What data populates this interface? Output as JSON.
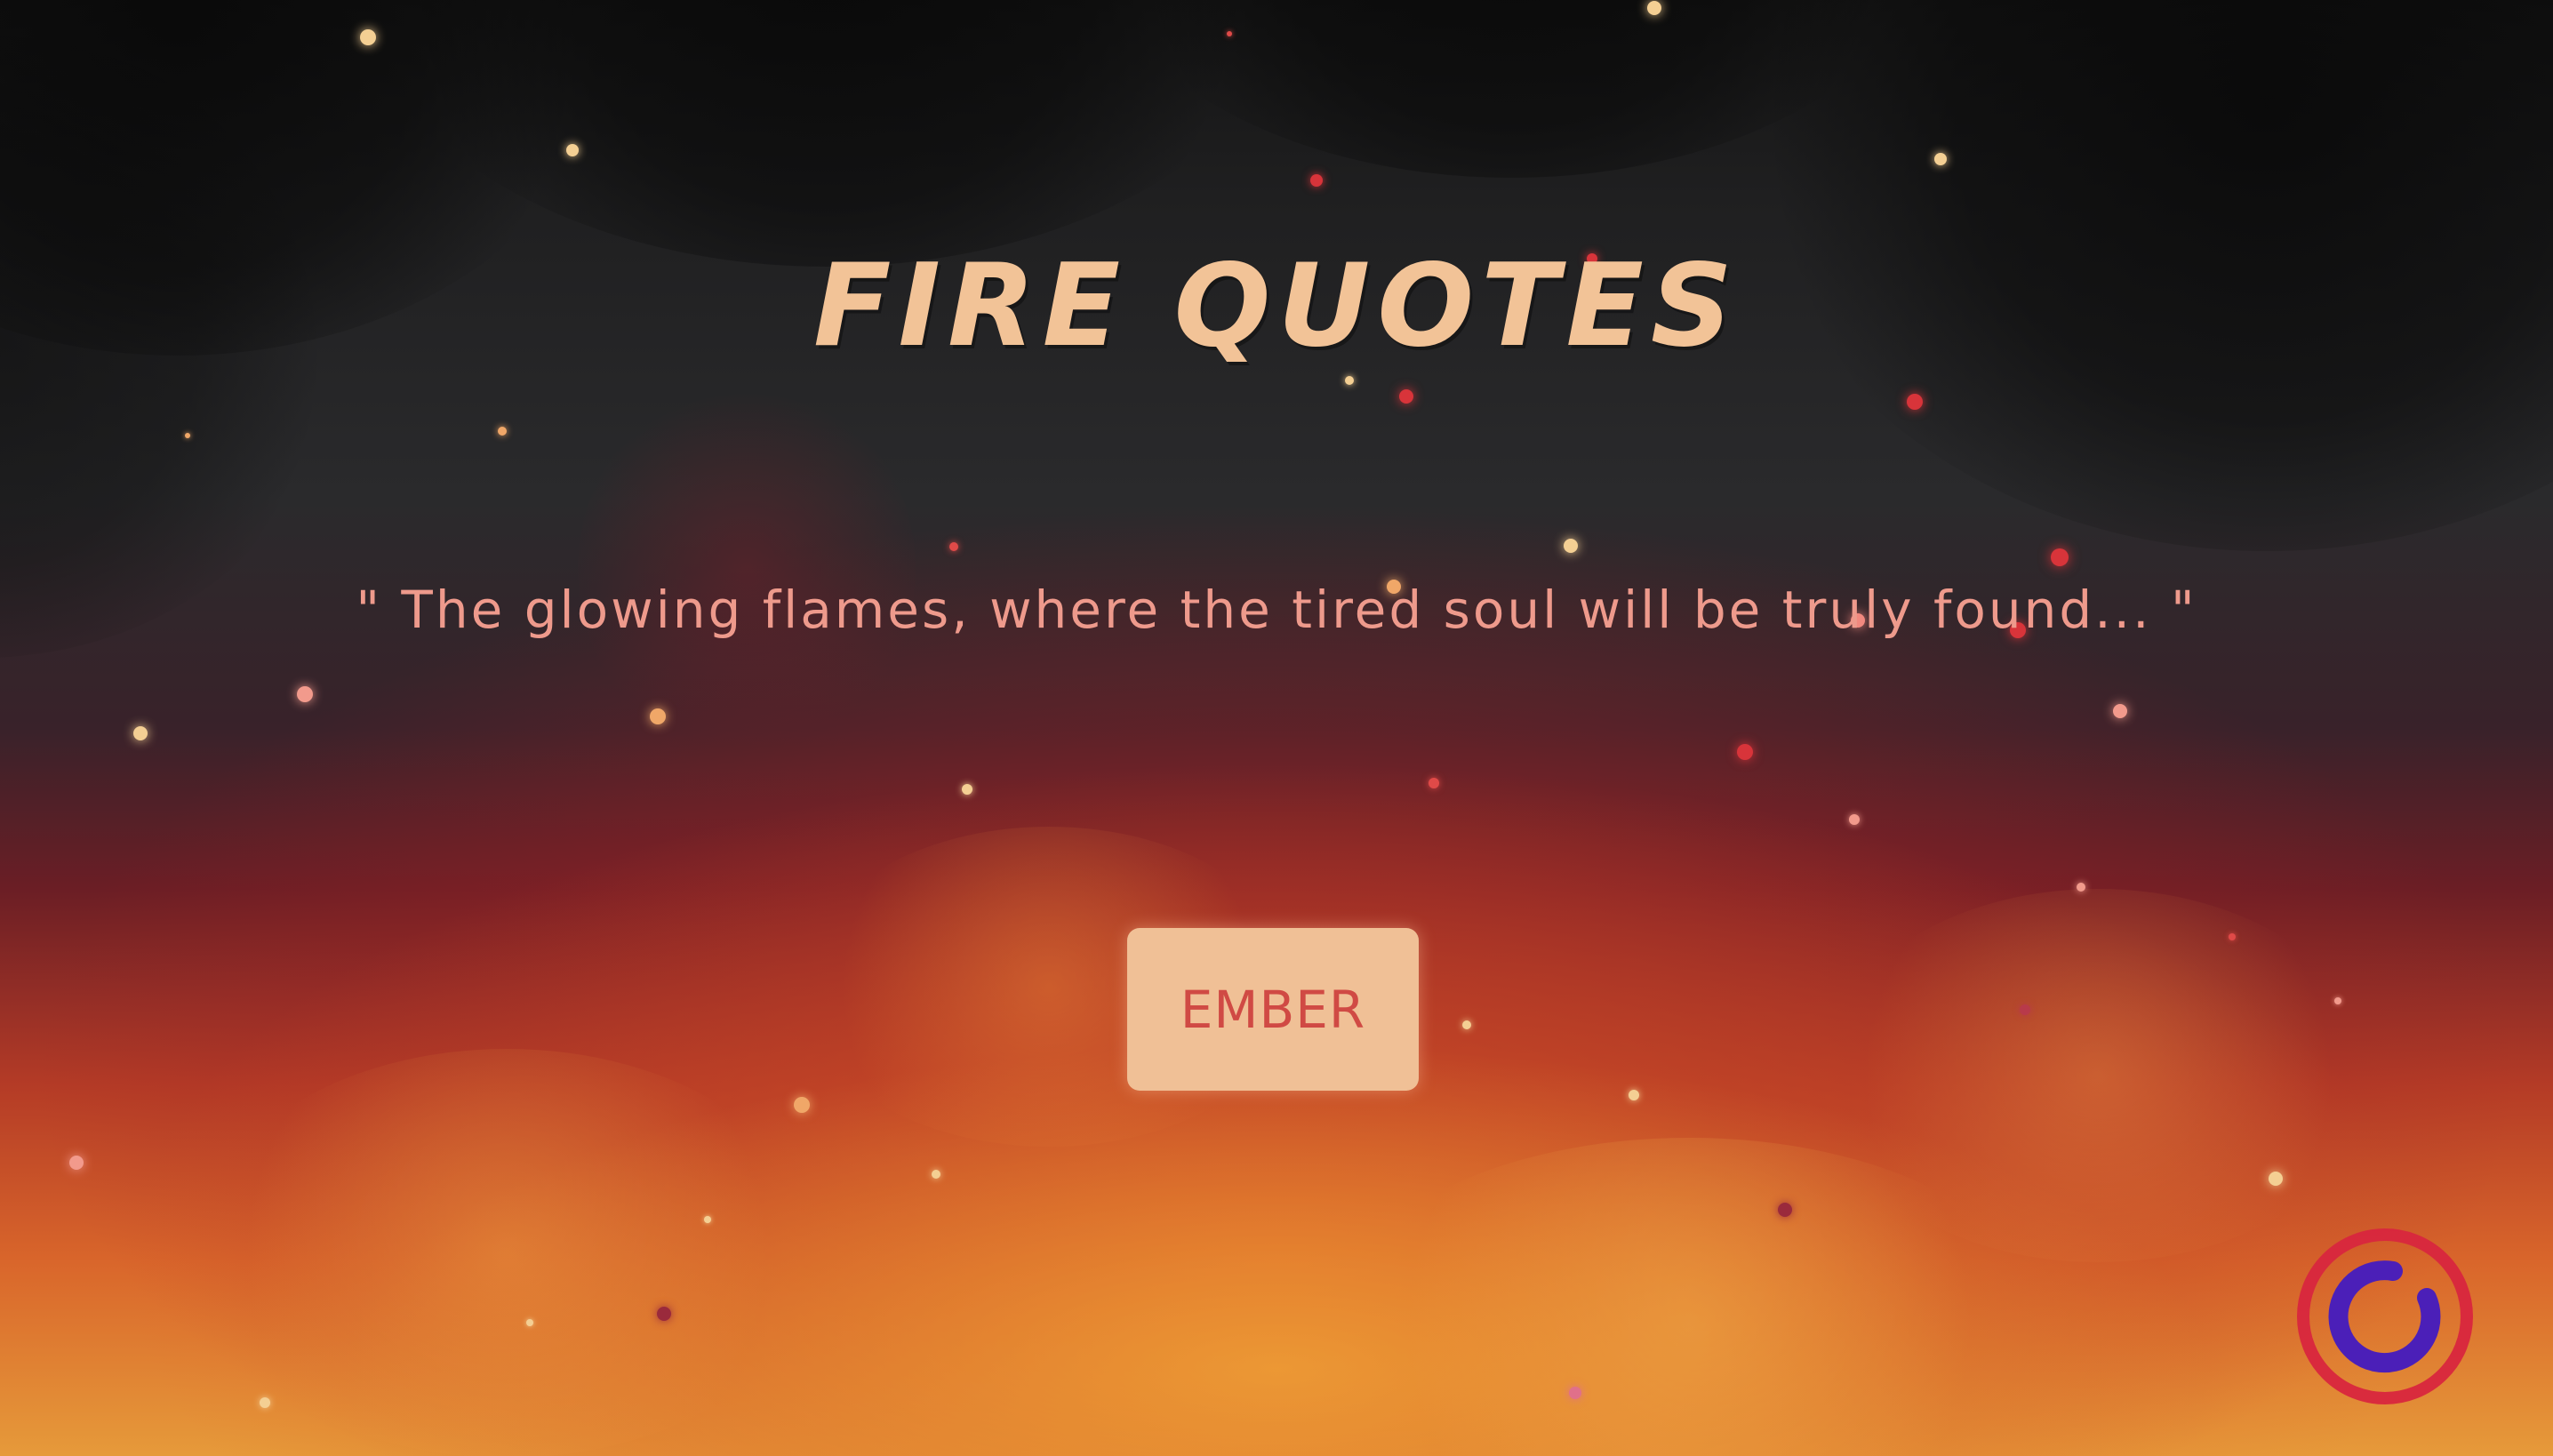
{
  "page": {
    "title": "FIRE QUOTES",
    "quote": "\" The glowing flames, where the tired soul will be truly found... \"",
    "button_label": "EMBER"
  },
  "icons": {
    "corner": "loading-spinner-icon"
  },
  "colors": {
    "title": "#f2c397",
    "quote": "#ee9a8c",
    "button_bg": "#f0c096",
    "button_text": "#d04a44",
    "spinner_outer": "#d8263e",
    "spinner_inner": "#4b1fb8"
  }
}
